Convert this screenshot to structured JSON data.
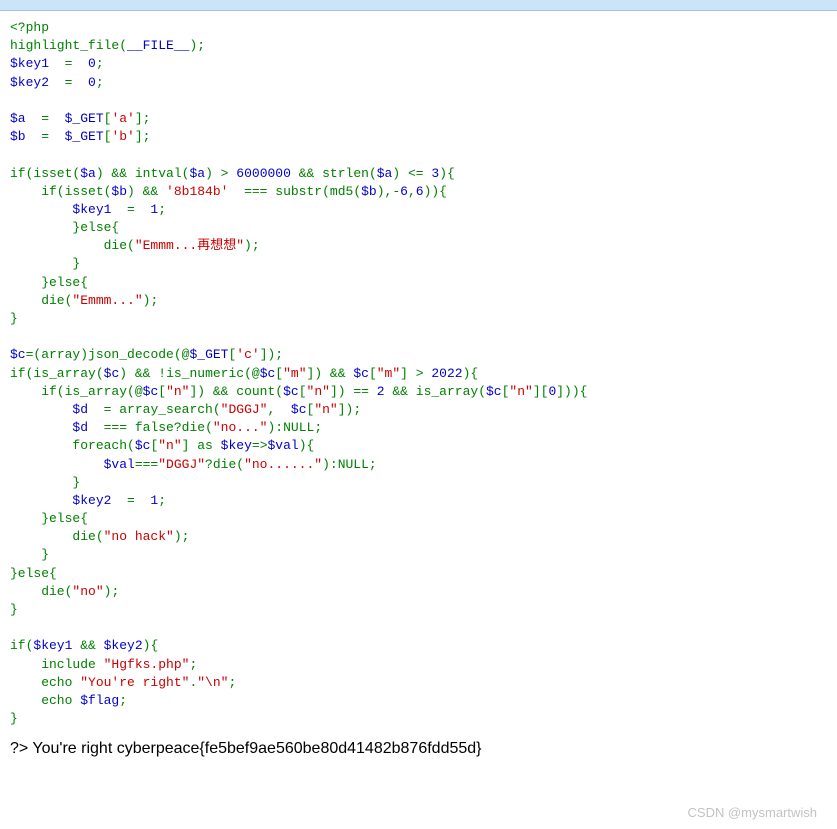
{
  "code": {
    "l1a": "<?php",
    "l2a": "highlight_file",
    "l2b": "(",
    "l2c": "__FILE__",
    "l2d": ");",
    "l3a": "$key1 ",
    "l3b": " = ",
    "l3c": " 0",
    "l3d": ";",
    "l4a": "$key2 ",
    "l4b": " = ",
    "l4c": " 0",
    "l4d": ";",
    "l6a": "$a ",
    "l6b": " = ",
    "l6c": " $_GET",
    "l6d": "[",
    "l6e": "'a'",
    "l6f": "];",
    "l7a": "$b ",
    "l7b": " = ",
    "l7c": " $_GET",
    "l7d": "[",
    "l7e": "'b'",
    "l7f": "];",
    "l9a": "if(isset(",
    "l9b": "$a",
    "l9c": ") && ",
    "l9d": "intval",
    "l9e": "(",
    "l9f": "$a",
    "l9g": ") > ",
    "l9h": "6000000 ",
    "l9i": "&& ",
    "l9j": "strlen",
    "l9k": "(",
    "l9l": "$a",
    "l9m": ") <= ",
    "l9n": "3",
    "l9o": "){",
    "l10a": "    if(isset(",
    "l10b": "$b",
    "l10c": ") && ",
    "l10d": "'8b184b' ",
    "l10e": " === ",
    "l10f": "substr",
    "l10g": "(",
    "l10h": "md5",
    "l10i": "(",
    "l10j": "$b",
    "l10k": "),-",
    "l10l": "6",
    "l10m": ",",
    "l10n": "6",
    "l10o": ")){",
    "l11a": "        $key1 ",
    "l11b": " = ",
    "l11c": " 1",
    "l11d": ";",
    "l12a": "        }else{",
    "l13a": "            die(",
    "l13b": "\"Emmm...再想想\"",
    "l13c": ");",
    "l14a": "        }",
    "l15a": "    }else{",
    "l16a": "    die(",
    "l16b": "\"Emmm...\"",
    "l16c": ");",
    "l17a": "}",
    "l19a": "$c",
    "l19b": "=(array)",
    "l19c": "json_decode",
    "l19d": "(@",
    "l19e": "$_GET",
    "l19f": "[",
    "l19g": "'c'",
    "l19h": "]);",
    "l20a": "if(",
    "l20b": "is_array",
    "l20c": "(",
    "l20d": "$c",
    "l20e": ") && !",
    "l20f": "is_numeric",
    "l20g": "(@",
    "l20h": "$c",
    "l20i": "[",
    "l20j": "\"m\"",
    "l20k": "]) && ",
    "l20l": "$c",
    "l20m": "[",
    "l20n": "\"m\"",
    "l20o": "] > ",
    "l20p": "2022",
    "l20q": "){",
    "l21a": "    if(",
    "l21b": "is_array",
    "l21c": "(@",
    "l21d": "$c",
    "l21e": "[",
    "l21f": "\"n\"",
    "l21g": "]) && ",
    "l21h": "count",
    "l21i": "(",
    "l21j": "$c",
    "l21k": "[",
    "l21l": "\"n\"",
    "l21m": "]) == ",
    "l21n": "2 ",
    "l21o": "&& ",
    "l21p": "is_array",
    "l21q": "(",
    "l21r": "$c",
    "l21s": "[",
    "l21t": "\"n\"",
    "l21u": "][",
    "l21v": "0",
    "l21w": "])){",
    "l22a": "        $d ",
    "l22b": " = ",
    "l22c": "array_search",
    "l22d": "(",
    "l22e": "\"DGGJ\"",
    "l22f": ", ",
    "l22g": " $c",
    "l22h": "[",
    "l22i": "\"n\"",
    "l22j": "]);",
    "l23a": "        $d ",
    "l23b": " === ",
    "l23c": "false",
    "l23d": "?die(",
    "l23e": "\"no...\"",
    "l23f": "):",
    "l23g": "NULL",
    "l23h": ";",
    "l24a": "        foreach(",
    "l24b": "$c",
    "l24c": "[",
    "l24d": "\"n\"",
    "l24e": "] as ",
    "l24f": "$key",
    "l24g": "=>",
    "l24h": "$val",
    "l24i": "){",
    "l25a": "            $val",
    "l25b": "===",
    "l25c": "\"DGGJ\"",
    "l25d": "?die(",
    "l25e": "\"no......\"",
    "l25f": "):",
    "l25g": "NULL",
    "l25h": ";",
    "l26a": "        }",
    "l27a": "        $key2 ",
    "l27b": " = ",
    "l27c": " 1",
    "l27d": ";",
    "l28a": "    }else{",
    "l29a": "        die(",
    "l29b": "\"no hack\"",
    "l29c": ");",
    "l30a": "    }",
    "l31a": "}else{",
    "l32a": "    die(",
    "l32b": "\"no\"",
    "l32c": ");",
    "l33a": "}",
    "l35a": "if(",
    "l35b": "$key1 ",
    "l35c": "&& ",
    "l35d": "$key2",
    "l35e": "){",
    "l36a": "    include ",
    "l36b": "\"Hgfks.php\"",
    "l36c": ";",
    "l37a": "    echo ",
    "l37b": "\"You're right\"",
    "l37c": ".",
    "l37d": "\"\\n\"",
    "l37e": ";",
    "l38a": "    echo ",
    "l38b": "$flag",
    "l38c": ";",
    "l39a": "}"
  },
  "output_prefix": "?> ",
  "output_text": "You're right cyberpeace{fe5bef9ae560be80d41482b876fdd55d}",
  "watermark": "CSDN @mysmartwish"
}
